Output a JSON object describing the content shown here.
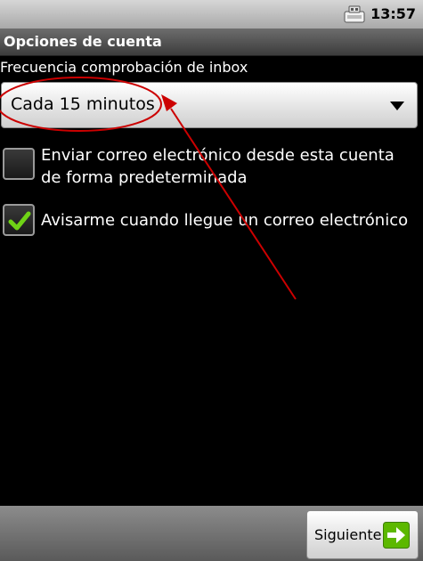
{
  "status_bar": {
    "time": "13:57",
    "usb_icon": "usb-debug-icon"
  },
  "title_bar": {
    "title": "Opciones de cuenta"
  },
  "frequency": {
    "label": "Frecuencia comprobación de inbox",
    "selected_value": "Cada 15 minutos",
    "arrow_icon": "dropdown-arrow-icon"
  },
  "options": {
    "default_account": {
      "label": "Enviar correo electrónico desde esta cuenta de forma predeterminada",
      "checked": false
    },
    "notify": {
      "label": "Avisarme cuando llegue un correo electrónico",
      "checked": true
    }
  },
  "bottom_bar": {
    "next_label": "Siguiente",
    "next_icon": "arrow-right-icon"
  },
  "colors": {
    "annotation_red": "#cc0000",
    "check_green": "#6fd316",
    "next_icon_green": "#5cb800"
  }
}
